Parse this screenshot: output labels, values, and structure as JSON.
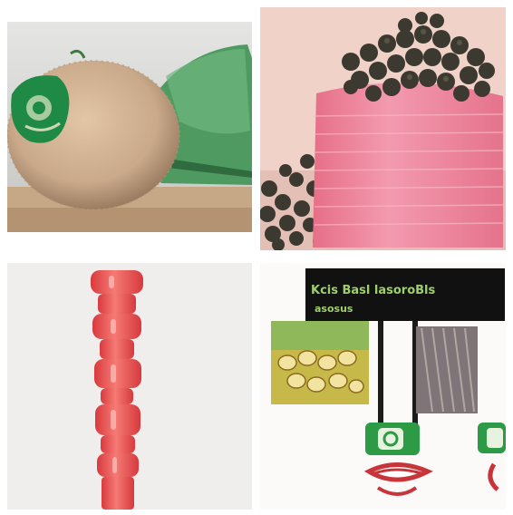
{
  "grid": {
    "tiles": [
      {
        "name": "coconut-tile"
      },
      {
        "name": "pink-spool-tile"
      },
      {
        "name": "red-column-tile"
      },
      {
        "name": "sign-tile"
      }
    ]
  },
  "sign": {
    "line1": "Kcis Basl lasoroBls",
    "line2": "asosus"
  },
  "colors": {
    "coconut": "#c9a98a",
    "leaf": "#4f9a60",
    "spool": "#ee8ca1",
    "beads": "#3c3a30",
    "column": "#e9474a",
    "sign_bg": "#111111"
  }
}
